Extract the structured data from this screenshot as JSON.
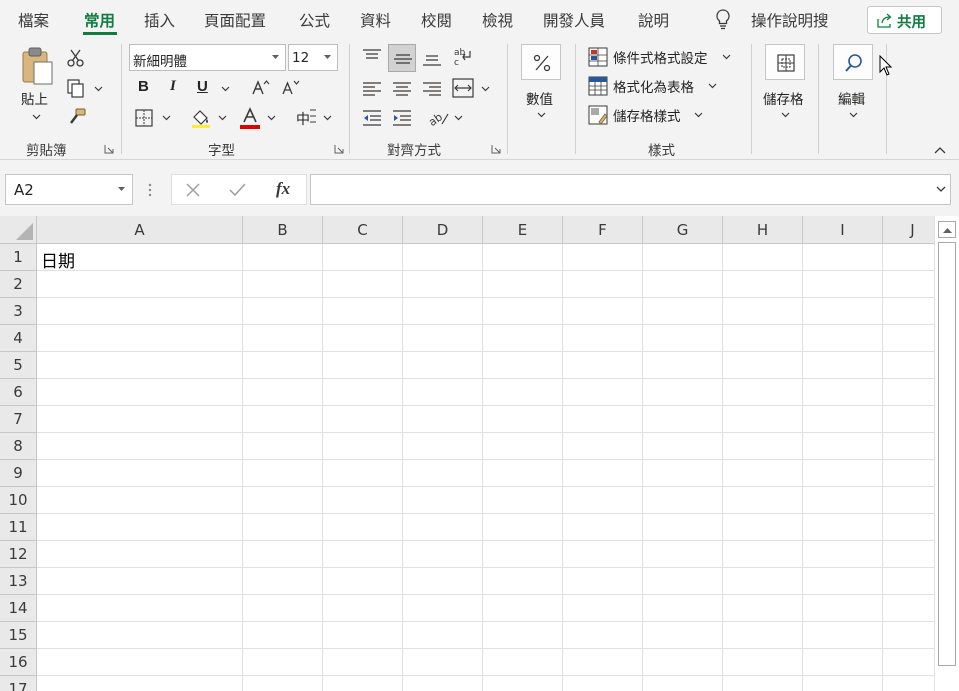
{
  "tabs": [
    {
      "label": "檔案"
    },
    {
      "label": "常用"
    },
    {
      "label": "插入"
    },
    {
      "label": "頁面配置"
    },
    {
      "label": "公式"
    },
    {
      "label": "資料"
    },
    {
      "label": "校閱"
    },
    {
      "label": "檢視"
    },
    {
      "label": "開發人員"
    },
    {
      "label": "說明"
    }
  ],
  "active_tab": "常用",
  "tell_me": {
    "label": "操作說明搜"
  },
  "share": {
    "label": "共用"
  },
  "ribbon": {
    "clipboard": {
      "paste_label": "貼上",
      "group_label": "剪貼簿"
    },
    "font": {
      "font_name": "新細明體",
      "font_size": "12",
      "group_label": "字型",
      "bold": "B",
      "italic": "I",
      "underline": "U",
      "phonetic": "中"
    },
    "alignment": {
      "group_label": "對齊方式"
    },
    "number": {
      "label": "數值"
    },
    "styles": {
      "conditional": "條件式格式設定",
      "as_table": "格式化為表格",
      "cell_styles": "儲存格樣式",
      "group_label": "樣式"
    },
    "cells": {
      "label": "儲存格"
    },
    "editing": {
      "label": "編輯"
    }
  },
  "formula_bar": {
    "name_box": "A2",
    "fx": "fx",
    "formula": ""
  },
  "grid": {
    "columns": [
      "A",
      "B",
      "C",
      "D",
      "E",
      "F",
      "G",
      "H",
      "I",
      "J"
    ],
    "rows": [
      "1",
      "2",
      "3",
      "4",
      "5",
      "6",
      "7",
      "8",
      "9",
      "10",
      "11",
      "12",
      "13",
      "14",
      "15",
      "16",
      "17"
    ],
    "cells": {
      "A1": "日期"
    }
  },
  "colors": {
    "accent": "#107c41",
    "font_color_bar": "#e00000"
  }
}
